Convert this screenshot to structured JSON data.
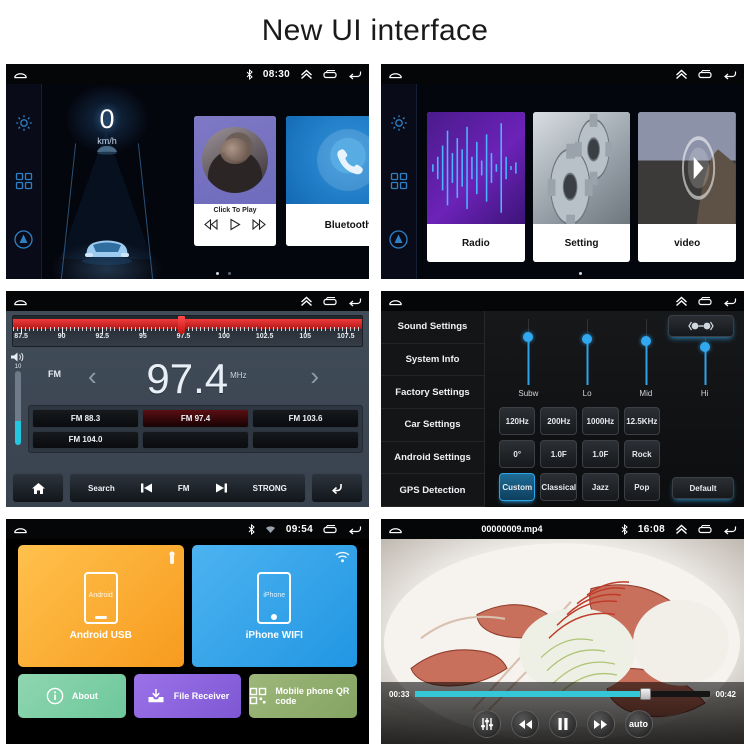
{
  "page": {
    "title": "New UI interface"
  },
  "panels": {
    "home": {
      "name": "home-dashboard",
      "statusbar": {
        "time": "08:30",
        "bluetooth_icon": "bluetooth-icon",
        "home_icon": "home-icon",
        "up_icon": "chevron-up-icon",
        "recents_icon": "recent-apps-icon",
        "back_icon": "back-icon"
      },
      "rail": [
        {
          "icon": "gear-icon",
          "label": "Settings"
        },
        {
          "icon": "grid-icon",
          "label": "Apps"
        },
        {
          "icon": "circle-a-icon",
          "label": "Auto"
        }
      ],
      "speed": {
        "value": "0",
        "unit": "km/h"
      },
      "music": {
        "title": "Click To Play",
        "prev": "prev-icon",
        "play": "play-icon",
        "next": "next-icon"
      },
      "bluetooth": {
        "label": "Bluetooth",
        "icon": "phone-icon"
      },
      "page_dots": 2,
      "active_dot": 0
    },
    "apps": {
      "name": "app-cards",
      "statusbar": {
        "home_icon": "home-icon",
        "up_icon": "chevron-up-icon",
        "recents_icon": "recent-apps-icon",
        "back_icon": "back-icon"
      },
      "rail": [
        {
          "icon": "gear-icon",
          "label": "Settings"
        },
        {
          "icon": "grid-icon",
          "label": "Apps"
        },
        {
          "icon": "circle-a-icon",
          "label": "Auto"
        }
      ],
      "cards": [
        {
          "label": "Radio",
          "art": "audio-waveform"
        },
        {
          "label": "Setting",
          "art": "gears"
        },
        {
          "label": "video",
          "art": "movie-poster"
        }
      ],
      "page_dots": 1,
      "active_dot": 0
    },
    "radio": {
      "name": "fm-radio",
      "statusbar": {
        "home_icon": "home-icon",
        "up_icon": "chevron-up-icon",
        "recents_icon": "recent-apps-icon",
        "back_icon": "back-icon"
      },
      "scale_ticks": [
        "87.5",
        "90",
        "92.5",
        "95",
        "97.5",
        "100",
        "102.5",
        "105",
        "107.5"
      ],
      "scale_min": 87.0,
      "scale_max": 108.5,
      "cursor_freq": 97.4,
      "band": "FM",
      "frequency": "97.4",
      "unit": "MHz",
      "prev_chevron": "chevron-left-icon",
      "next_chevron": "chevron-right-icon",
      "volume": {
        "level": "10",
        "percent": 32,
        "icon": "volume-icon"
      },
      "presets": [
        {
          "label": "FM 88.3",
          "active": false
        },
        {
          "label": "FM 97.4",
          "active": true
        },
        {
          "label": "FM 103.6",
          "active": false
        },
        {
          "label": "FM 104.0",
          "active": false
        },
        {
          "label": "",
          "active": false
        },
        {
          "label": "",
          "active": false
        }
      ],
      "toolbar": {
        "home": "home-icon",
        "search": "Search",
        "prev": "skip-prev-icon",
        "band": "FM",
        "next": "skip-next-icon",
        "signal": "STRONG",
        "back": "back-arrow-icon"
      }
    },
    "sound": {
      "name": "sound-settings",
      "statusbar": {
        "home_icon": "home-icon",
        "up_icon": "chevron-up-icon",
        "recents_icon": "recent-apps-icon",
        "back_icon": "back-icon"
      },
      "nav": [
        "Sound Settings",
        "System Info",
        "Factory Settings",
        "Car Settings",
        "Android Settings",
        "GPS Detection"
      ],
      "active_nav": 0,
      "sliders": [
        {
          "label": "Subw",
          "position": 18
        },
        {
          "label": "Lo",
          "position": 20
        },
        {
          "label": "Mid",
          "position": 22
        },
        {
          "label": "Hi",
          "position": 28
        }
      ],
      "balance_button": {
        "name": "balance-fader-button",
        "icon": "balance-icon"
      },
      "buttons": [
        {
          "label": "120Hz",
          "active": false
        },
        {
          "label": "200Hz",
          "active": false
        },
        {
          "label": "1000Hz",
          "active": false
        },
        {
          "label": "12.5KHz",
          "active": false
        },
        {
          "label": "0°",
          "active": false
        },
        {
          "label": "1.0F",
          "active": false
        },
        {
          "label": "1.0F",
          "active": false
        },
        {
          "label": "Rock",
          "active": false
        },
        {
          "label": "Custom",
          "active": true
        },
        {
          "label": "Classical",
          "active": false
        },
        {
          "label": "Jazz",
          "active": false
        },
        {
          "label": "Pop",
          "active": false
        }
      ],
      "default_button": "Default"
    },
    "link": {
      "name": "phone-link",
      "statusbar": {
        "time": "09:54",
        "bluetooth_icon": "bluetooth-icon",
        "wifi_icon": "wifi-icon",
        "home_icon": "home-icon",
        "recents_icon": "recent-apps-icon",
        "back_icon": "back-icon"
      },
      "tiles_big": [
        {
          "label": "Android USB",
          "corner_icon": "usb-icon",
          "device": "Android"
        },
        {
          "label": "iPhone WIFI",
          "corner_icon": "wifi-icon",
          "device": "iPhone"
        }
      ],
      "tiles_small": [
        {
          "label": "About",
          "icon": "info-icon"
        },
        {
          "label": "File Receiver",
          "icon": "download-box-icon"
        },
        {
          "label": "Mobile phone QR code",
          "icon": "qr-code-icon"
        }
      ]
    },
    "video": {
      "name": "video-player",
      "statusbar": {
        "file": "00000009.mp4",
        "time": "16:08",
        "bluetooth_icon": "bluetooth-icon",
        "home_icon": "home-icon",
        "up_icon": "chevron-up-icon",
        "recents_icon": "recent-apps-icon",
        "back_icon": "back-icon"
      },
      "progress": {
        "current": "00:33",
        "total": "00:42",
        "percent": 78
      },
      "controls": [
        {
          "name": "equalizer-button",
          "icon": "equalizer-icon",
          "label": ""
        },
        {
          "name": "prev-button",
          "icon": "skip-prev-icon",
          "label": ""
        },
        {
          "name": "pause-button",
          "icon": "pause-icon",
          "label": ""
        },
        {
          "name": "next-button",
          "icon": "skip-next-icon",
          "label": ""
        },
        {
          "name": "auto-button",
          "icon": "",
          "label": "auto"
        }
      ]
    }
  },
  "colors": {
    "accent_blue": "#2ea3e8",
    "radio_red": "#f03b3b",
    "android_orange": "#f79b1e",
    "iphone_blue": "#2196e3",
    "about_green": "#6ec79b",
    "file_purple": "#7e57d4",
    "qr_olive": "#85a462",
    "video_cyan": "#35c7d8"
  }
}
